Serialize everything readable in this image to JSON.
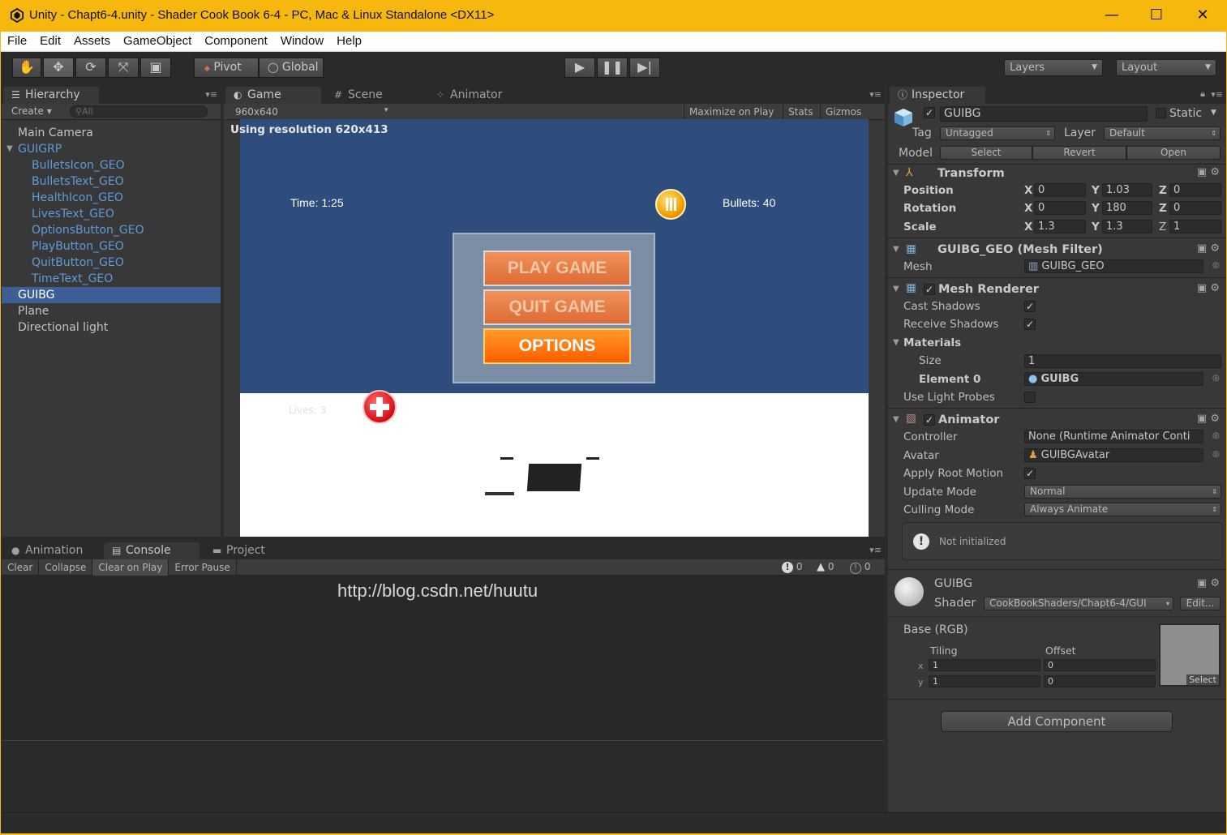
{
  "window": {
    "title": "Unity - Chapt6-4.unity - Shader Cook Book 6-4 - PC, Mac & Linux Standalone <DX11>",
    "minimize": "—",
    "maximize": "☐",
    "close": "✕"
  },
  "menu": [
    "File",
    "Edit",
    "Assets",
    "GameObject",
    "Component",
    "Window",
    "Help"
  ],
  "toolbar": {
    "pivot": "Pivot",
    "global": "Global",
    "layers": "Layers",
    "layout": "Layout"
  },
  "hierarchy": {
    "tab": "Hierarchy",
    "create": "Create",
    "search_placeholder": "All",
    "items": [
      {
        "label": "Main Camera",
        "indent": 0,
        "style": "normal"
      },
      {
        "label": "GUIGRP",
        "indent": 0,
        "style": "blue",
        "expanded": true
      },
      {
        "label": "BulletsIcon_GEO",
        "indent": 1,
        "style": "blue"
      },
      {
        "label": "BulletsText_GEO",
        "indent": 1,
        "style": "blue"
      },
      {
        "label": "HealthIcon_GEO",
        "indent": 1,
        "style": "blue"
      },
      {
        "label": "LivesText_GEO",
        "indent": 1,
        "style": "blue"
      },
      {
        "label": "OptionsButton_GEO",
        "indent": 1,
        "style": "blue"
      },
      {
        "label": "PlayButton_GEO",
        "indent": 1,
        "style": "blue"
      },
      {
        "label": "QuitButton_GEO",
        "indent": 1,
        "style": "blue"
      },
      {
        "label": "TimeText_GEO",
        "indent": 1,
        "style": "blue"
      },
      {
        "label": "GUIBG",
        "indent": 0,
        "style": "selected"
      },
      {
        "label": "Plane",
        "indent": 0,
        "style": "normal"
      },
      {
        "label": "Directional light",
        "indent": 0,
        "style": "normal"
      }
    ]
  },
  "game": {
    "tabs": [
      "Game",
      "Scene",
      "Animator"
    ],
    "resolution": "960x640",
    "maximize_on_play": "Maximize on Play",
    "stats": "Stats",
    "gizmos": "Gizmos",
    "notice": "Using resolution 620x413",
    "time_text": "Time: 1:25",
    "bullets_text": "Bullets: 40",
    "buttons": [
      "PLAY GAME",
      "QUIT GAME",
      "OPTIONS"
    ],
    "lives_text": "Lives: 3"
  },
  "bottom": {
    "tabs": [
      "Animation",
      "Console",
      "Project"
    ],
    "buttons": [
      "Clear",
      "Collapse",
      "Clear on Play",
      "Error Pause"
    ],
    "counts": {
      "errors": "0",
      "warnings": "0",
      "logs": "0"
    },
    "watermark": "http://blog.csdn.net/huutu"
  },
  "inspector": {
    "tab": "Inspector",
    "object_name": "GUIBG",
    "static_label": "Static",
    "tag_label": "Tag",
    "tag_value": "Untagged",
    "layer_label": "Layer",
    "layer_value": "Default",
    "model_label": "Model",
    "model_buttons": [
      "Select",
      "Revert",
      "Open"
    ],
    "transform": {
      "title": "Transform",
      "position_label": "Position",
      "rotation_label": "Rotation",
      "scale_label": "Scale",
      "position": {
        "x": "0",
        "y": "1.03",
        "z": "0"
      },
      "rotation": {
        "x": "0",
        "y": "180",
        "z": "0"
      },
      "scale": {
        "x": "1.3",
        "y": "1.3",
        "z": "1"
      }
    },
    "mesh_filter": {
      "title": "GUIBG_GEO (Mesh Filter)",
      "mesh_label": "Mesh",
      "mesh_value": "GUIBG_GEO"
    },
    "mesh_renderer": {
      "title": "Mesh Renderer",
      "cast_shadows": "Cast Shadows",
      "receive_shadows": "Receive Shadows",
      "materials": "Materials",
      "size_label": "Size",
      "size_value": "1",
      "element_label": "Element 0",
      "element_value": "GUIBG",
      "use_light_probes": "Use Light Probes"
    },
    "animator": {
      "title": "Animator",
      "controller_label": "Controller",
      "controller_value": "None (Runtime Animator Conti",
      "avatar_label": "Avatar",
      "avatar_value": "GUIBGAvatar",
      "apply_root_motion": "Apply Root Motion",
      "update_mode_label": "Update Mode",
      "update_mode_value": "Normal",
      "culling_mode_label": "Culling Mode",
      "culling_mode_value": "Always Animate",
      "warning": "Not initialized"
    },
    "material": {
      "name": "GUIBG",
      "shader_label": "Shader",
      "shader_value": "CookBookShaders/Chapt6-4/GUI",
      "edit_button": "Edit...",
      "base_label": "Base (RGB)",
      "tiling_label": "Tiling",
      "offset_label": "Offset",
      "x_label": "x",
      "y_label": "y",
      "tiling": {
        "x": "1",
        "y": "1"
      },
      "offset": {
        "x": "0",
        "y": "0"
      },
      "select_label": "Select"
    },
    "add_component": "Add Component"
  },
  "colors": {
    "titlebar": "#f6b80e",
    "selection": "#3e5f96",
    "game_bg": "#2f4d7c",
    "hierarchy_prefab": "#5f9bd8"
  }
}
